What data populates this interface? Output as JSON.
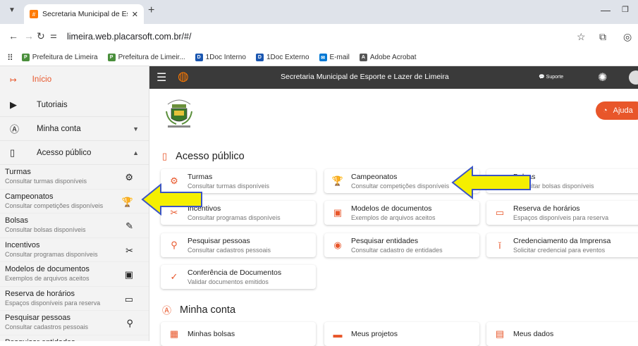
{
  "browser": {
    "tab_title": "Secretaria Municipal de Esporte",
    "tab_favicon": "#",
    "url": "limeira.web.placarsoft.com.br/#/",
    "bookmarks": [
      {
        "label": "Prefeitura de Limeira",
        "color": "#4a8f3c",
        "icon": "P"
      },
      {
        "label": "Prefeitura de Limeir...",
        "color": "#4a8f3c",
        "icon": "P"
      },
      {
        "label": "1Doc Interno",
        "color": "#1a56b0",
        "icon": "D"
      },
      {
        "label": "1Doc Externo",
        "color": "#1a56b0",
        "icon": "D"
      },
      {
        "label": "E-mail",
        "color": "#0078d4",
        "icon": "✉"
      },
      {
        "label": "Adobe Acrobat",
        "color": "#555555",
        "icon": "A"
      }
    ]
  },
  "sidebar": {
    "home_label": "Início",
    "sections": [
      {
        "label": "Tutoriais",
        "icon": "youtube-icon"
      },
      {
        "label": "Minha conta",
        "icon": "account-icon",
        "caret": "▼"
      },
      {
        "label": "Acesso público",
        "icon": "door-icon",
        "caret": "▲"
      }
    ],
    "items": [
      {
        "title": "Turmas",
        "subtitle": "Consultar turmas disponíveis",
        "glyph": "⚙"
      },
      {
        "title": "Campeonatos",
        "subtitle": "Consultar competições disponíveis",
        "glyph": "🏆"
      },
      {
        "title": "Bolsas",
        "subtitle": "Consultar bolsas disponíveis",
        "glyph": "✎"
      },
      {
        "title": "Incentivos",
        "subtitle": "Consultar programas disponíveis",
        "glyph": "✂"
      },
      {
        "title": "Modelos de documentos",
        "subtitle": "Exemplos de arquivos aceitos",
        "glyph": "▣"
      },
      {
        "title": "Reserva de horários",
        "subtitle": "Espaços disponíveis para reserva",
        "glyph": "▭"
      },
      {
        "title": "Pesquisar pessoas",
        "subtitle": "Consultar cadastros pessoais",
        "glyph": "⚲"
      },
      {
        "title": "Pesquisar entidades",
        "subtitle": "",
        "glyph": "◆"
      }
    ]
  },
  "appbar": {
    "title": "Secretaria Municipal de Esporte e Lazer de Limeira",
    "support_label": "Suporte"
  },
  "main": {
    "help_label": "Ajuda",
    "sections": {
      "public_title": "Acesso público",
      "account_title": "Minha conta"
    },
    "public_cards": [
      {
        "title": "Turmas",
        "subtitle": "Consultar turmas disponíveis",
        "glyph": "⚙"
      },
      {
        "title": "Campeonatos",
        "subtitle": "Consultar competições disponíveis",
        "glyph": "🏆"
      },
      {
        "title": "Bolsas",
        "subtitle": "Consultar bolsas disponíveis",
        "glyph": "✎"
      },
      {
        "title": "Incentivos",
        "subtitle": "Consultar programas disponíveis",
        "glyph": "✂"
      },
      {
        "title": "Modelos de documentos",
        "subtitle": "Exemplos de arquivos aceitos",
        "glyph": "▣"
      },
      {
        "title": "Reserva de horários",
        "subtitle": "Espaços disponíveis para reserva",
        "glyph": "▭"
      },
      {
        "title": "Pesquisar pessoas",
        "subtitle": "Consultar cadastros pessoais",
        "glyph": "⚲"
      },
      {
        "title": "Pesquisar entidades",
        "subtitle": "Consultar cadastro de entidades",
        "glyph": "◉"
      },
      {
        "title": "Credenciamento da Imprensa",
        "subtitle": "Solicitar credencial para eventos",
        "glyph": "ǐ"
      },
      {
        "title": "Conferência de Documentos",
        "subtitle": "Validar documentos emitidos",
        "glyph": "✓"
      }
    ],
    "account_cards": [
      {
        "title": "Minhas bolsas",
        "glyph": "▦"
      },
      {
        "title": "Meus projetos",
        "glyph": "▬"
      },
      {
        "title": "Meus dados",
        "glyph": "▤"
      }
    ]
  },
  "colors": {
    "accent": "#e8562a",
    "appbar": "#3a3a3a",
    "arrow_fill": "#f5ef00",
    "arrow_stroke": "#3b55c6"
  }
}
